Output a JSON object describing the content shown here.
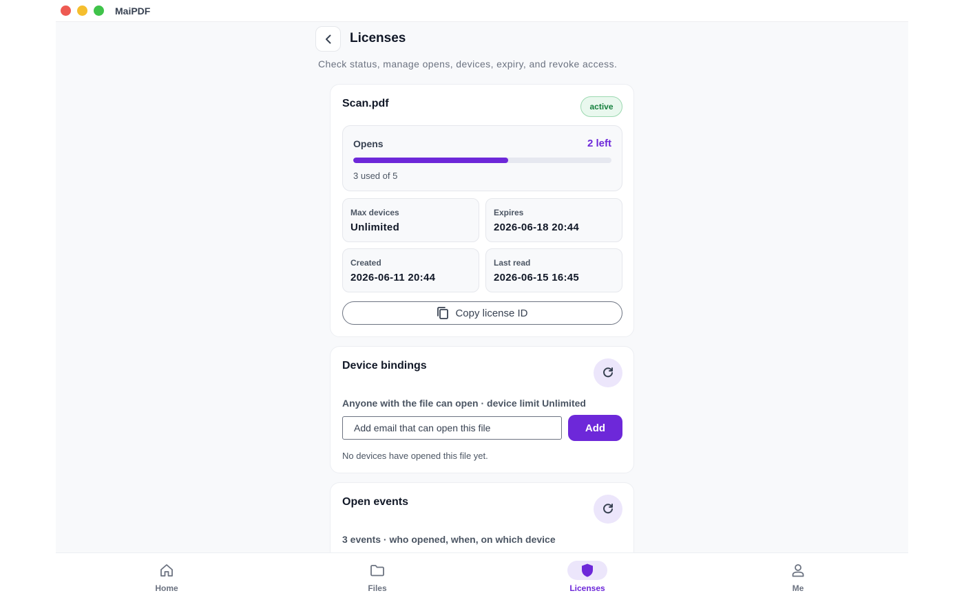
{
  "window": {
    "app_title": "MaiPDF"
  },
  "header": {
    "title": "Licenses",
    "subtitle": "Check status, manage opens, devices, expiry, and revoke access."
  },
  "license": {
    "file_name": "Scan.pdf",
    "status": "active",
    "opens": {
      "label": "Opens",
      "left_text": "2 left",
      "used_text": "3 used of 5",
      "used": 3,
      "total": 5
    },
    "stats": [
      {
        "label": "Max devices",
        "value": "Unlimited"
      },
      {
        "label": "Expires",
        "value": "2026-06-18 20:44"
      },
      {
        "label": "Created",
        "value": "2026-06-11 20:44"
      },
      {
        "label": "Last read",
        "value": "2026-06-15 16:45"
      }
    ],
    "copy_label": "Copy license ID"
  },
  "devices": {
    "title": "Device bindings",
    "description": "Anyone with the file can open · device limit Unlimited",
    "email_placeholder": "Add email that can open this file",
    "add_label": "Add",
    "empty_text": "No devices have opened this file yet."
  },
  "events": {
    "title": "Open events",
    "description": "3 events · who opened, when, on which device"
  },
  "nav": [
    {
      "label": "Home",
      "icon": "home-icon",
      "active": false
    },
    {
      "label": "Files",
      "icon": "folder-icon",
      "active": false
    },
    {
      "label": "Licenses",
      "icon": "shield-icon",
      "active": true
    },
    {
      "label": "Me",
      "icon": "person-icon",
      "active": false
    }
  ],
  "colors": {
    "accent": "#6d28d9",
    "active_badge_text": "#15803d",
    "active_badge_bg": "#e9f8ee"
  }
}
